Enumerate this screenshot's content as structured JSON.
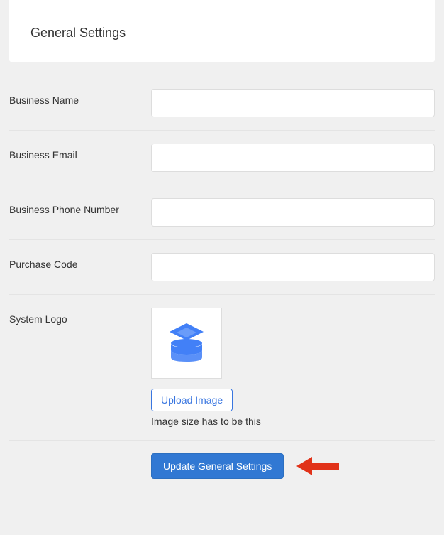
{
  "header": {
    "title": "General Settings"
  },
  "form": {
    "business_name": {
      "label": "Business Name",
      "value": ""
    },
    "business_email": {
      "label": "Business Email",
      "value": ""
    },
    "business_phone": {
      "label": "Business Phone Number",
      "value": ""
    },
    "purchase_code": {
      "label": "Purchase Code",
      "value": ""
    },
    "system_logo": {
      "label": "System Logo",
      "upload_label": "Upload Image",
      "help": "Image size has to be this"
    },
    "submit_label": "Update General Settings"
  },
  "colors": {
    "primary_button": "#3178d3",
    "outline_button": "#3976e0",
    "arrow": "#e13219",
    "logo_icon": "#4280f7"
  }
}
